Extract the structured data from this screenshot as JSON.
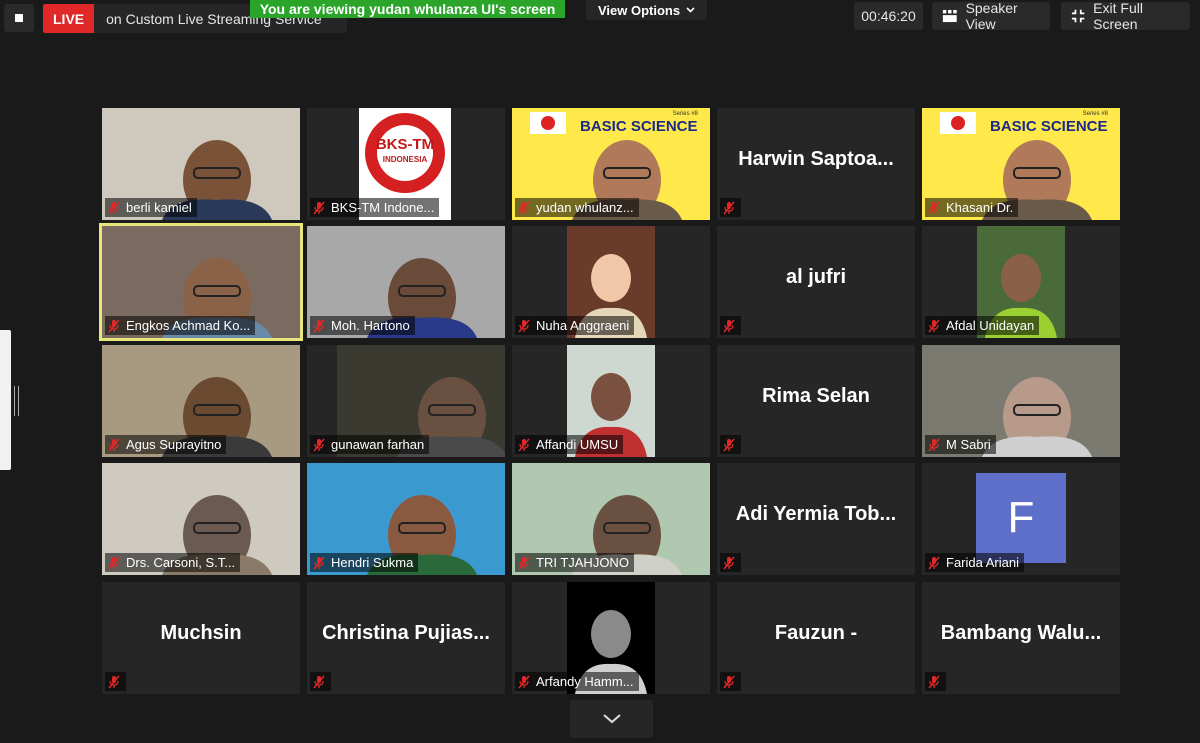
{
  "topbar": {
    "live_badge": "LIVE",
    "live_text": "on Custom Live Streaming Service",
    "viewing_banner": "You are viewing yudan whulanza UI's screen",
    "view_options": "View Options",
    "timer": "00:46:20",
    "speaker_view": "Speaker View",
    "exit_full_screen": "Exit Full Screen"
  },
  "colors": {
    "live": "#e02828",
    "banner": "#2aa52a",
    "active_speaker_border": "#e6e67a",
    "muted_mic": "#e02828",
    "avatar_F": "#5e6fc9",
    "basic_science_bg": "#ffe94a"
  },
  "basic_science": {
    "title": "BASIC SCIENCE",
    "series": "Series #8"
  },
  "bks_logo": {
    "line1": "BKS-TM",
    "line2": "INDONESIA"
  },
  "participants": [
    {
      "name": "berli kamiel",
      "video": "camera"
    },
    {
      "name": "BKS-TM Indone...",
      "video": "logo"
    },
    {
      "name": "yudan whulanz...",
      "video": "basic-science"
    },
    {
      "name": "Harwin  Saptoa...",
      "video": "none"
    },
    {
      "name": "Khasani Dr.",
      "video": "basic-science"
    },
    {
      "name": "Engkos Achmad Ko...",
      "video": "camera",
      "active": true
    },
    {
      "name": "Moh. Hartono",
      "video": "camera"
    },
    {
      "name": "Nuha Anggraeni",
      "video": "photo"
    },
    {
      "name": "al jufri",
      "video": "none"
    },
    {
      "name": "Afdal Unidayan",
      "video": "photo"
    },
    {
      "name": "Agus Suprayitno",
      "video": "camera"
    },
    {
      "name": "gunawan farhan",
      "video": "camera"
    },
    {
      "name": "Affandi UMSU",
      "video": "photo"
    },
    {
      "name": "Rima Selan",
      "video": "none"
    },
    {
      "name": "M Sabri",
      "video": "camera"
    },
    {
      "name": "Drs. Carsoni, S.T...",
      "video": "camera"
    },
    {
      "name": "Hendri Sukma",
      "video": "camera"
    },
    {
      "name": "TRI TJAHJONO",
      "video": "camera"
    },
    {
      "name": "Adi  Yermia  Tob...",
      "video": "none"
    },
    {
      "name": "Farida Ariani",
      "video": "avatar",
      "avatar_letter": "F"
    },
    {
      "name": "Muchsin",
      "video": "none"
    },
    {
      "name": "Christina  Pujias...",
      "video": "none"
    },
    {
      "name": "Arfandy Hamm...",
      "video": "photo"
    },
    {
      "name": "Fauzun -",
      "video": "none"
    },
    {
      "name": "Bambang  Walu...",
      "video": "none"
    }
  ]
}
